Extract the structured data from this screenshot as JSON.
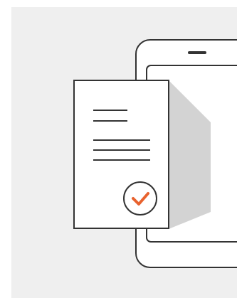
{
  "illustration": {
    "subject": "document-approved-on-tablet",
    "icons": [
      "tablet-icon",
      "document-icon",
      "checkmark-icon"
    ],
    "colors": {
      "page_background": "#ffffff",
      "panel_background": "#efefef",
      "outline": "#333333",
      "document_fill": "#ffffff",
      "screen_fill": "#ffffff",
      "shadow": "#d3d3d3",
      "check_accent": "#e8622e"
    },
    "document_text_lines": 4
  }
}
